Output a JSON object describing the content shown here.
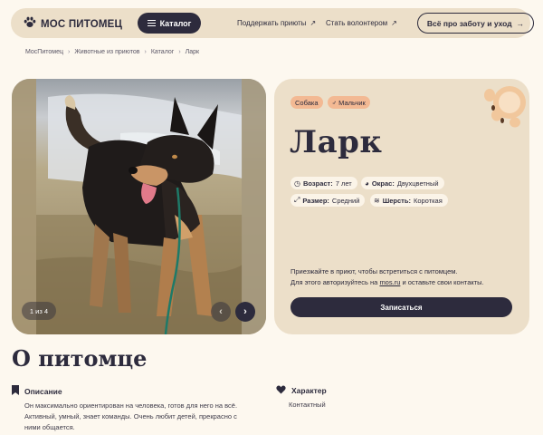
{
  "header": {
    "logo_text": "МОС ПИТОМЕЦ",
    "catalog_label": "Каталог",
    "nav": [
      "Поддержать приюты",
      "Стать волонтером"
    ],
    "care_label": "Всё про заботу и уход"
  },
  "breadcrumbs": [
    "МосПитомец",
    "Животные из приютов",
    "Каталог",
    "Ларк"
  ],
  "gallery": {
    "counter": "1 из 4"
  },
  "pet": {
    "tags": [
      {
        "icon": "dog-icon",
        "label": "Собака"
      },
      {
        "icon": "male-icon",
        "label": "Мальчик"
      }
    ],
    "name": "Ларк",
    "attributes": {
      "age": {
        "label": "Возраст:",
        "value": "7 лет"
      },
      "color": {
        "label": "Окрас:",
        "value": "Двухцветный"
      },
      "size": {
        "label": "Размер:",
        "value": "Средний"
      },
      "coat": {
        "label": "Шерсть:",
        "value": "Короткая"
      }
    },
    "info_line1": "Приезжайте в приют, чтобы встретиться с питомцем.",
    "info_line2_before": "Для этого авторизуйтесь на ",
    "info_link": "mos.ru",
    "info_line2_after": " и оставьте свои контакты.",
    "signup_label": "Записаться"
  },
  "about": {
    "title": "О питомце",
    "description": {
      "heading": "Описание",
      "lines": [
        "Он максимально ориентирован на человека, готов для него на всё.",
        "Активный, умный, знает команды. Очень любит детей, прекрасно с",
        "ними общается."
      ]
    },
    "character": {
      "heading": "Характер",
      "text": "Контактный"
    }
  },
  "colors": {
    "dark": "#2d2b3d",
    "beige": "#ecdfc9",
    "peach": "#f3b993",
    "page_bg": "#fdf8ef"
  }
}
